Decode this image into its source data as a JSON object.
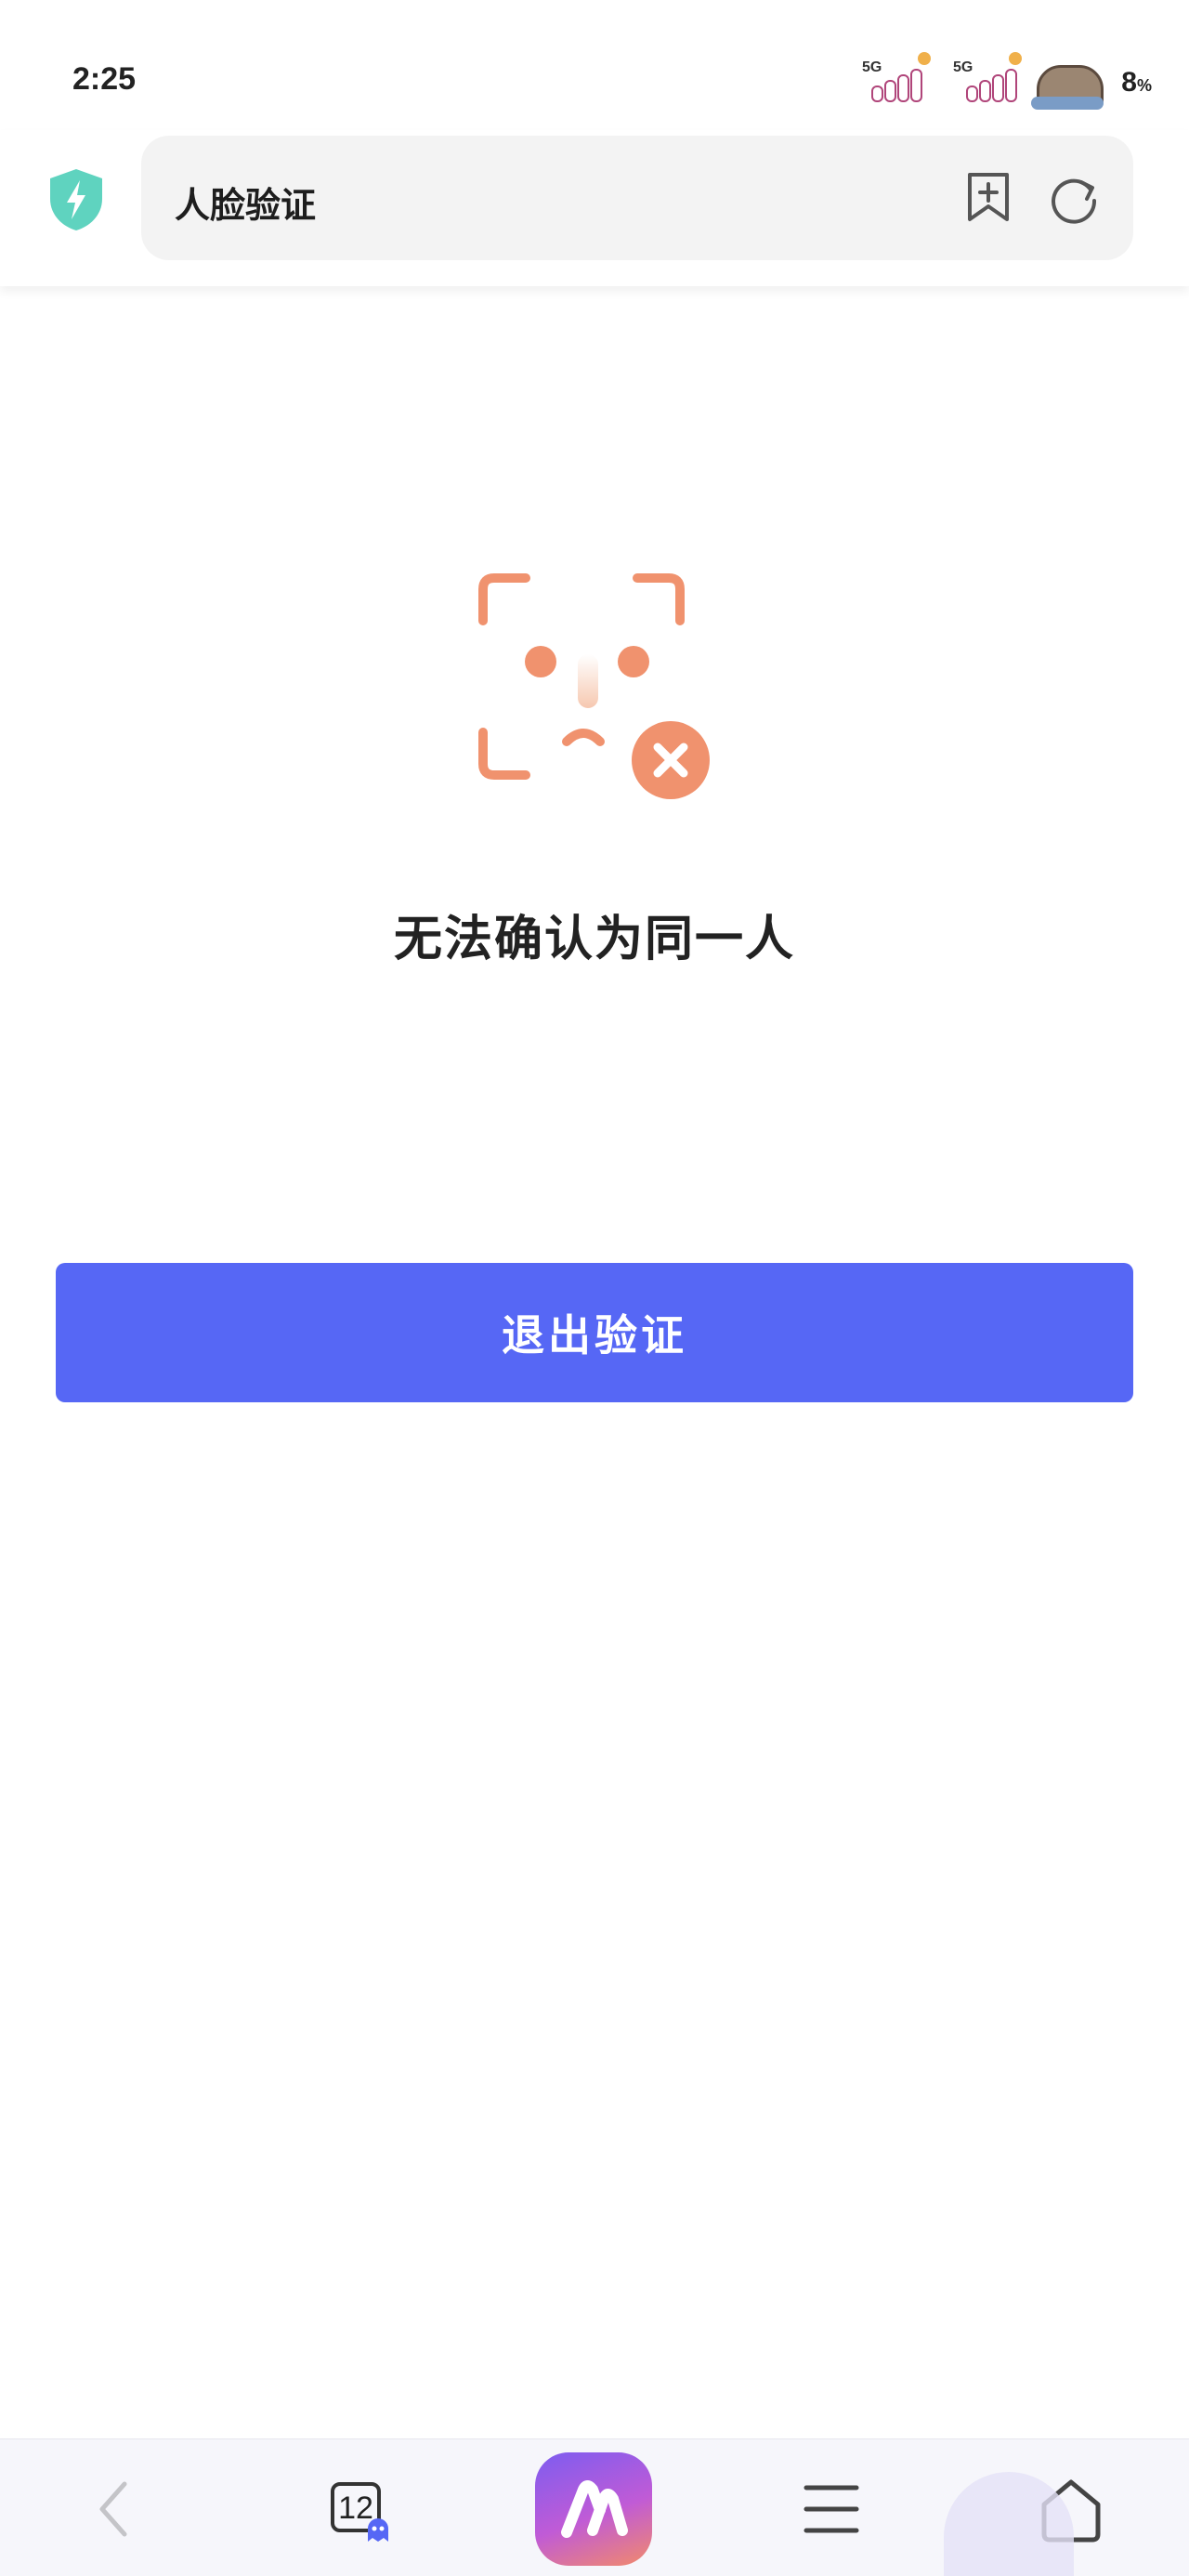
{
  "status_bar": {
    "time": "2:25",
    "signal_1_label": "5G",
    "signal_2_label": "5G",
    "battery_percent": "8",
    "battery_unit": "%"
  },
  "address_bar": {
    "title": "人脸验证",
    "shield_color": "#5fd3bf"
  },
  "main": {
    "message": "无法确认为同一人",
    "exit_button_label": "退出验证",
    "icon_color": "#f0926e"
  },
  "bottom_nav": {
    "tab_count": "12",
    "accent": "#5667f5"
  }
}
